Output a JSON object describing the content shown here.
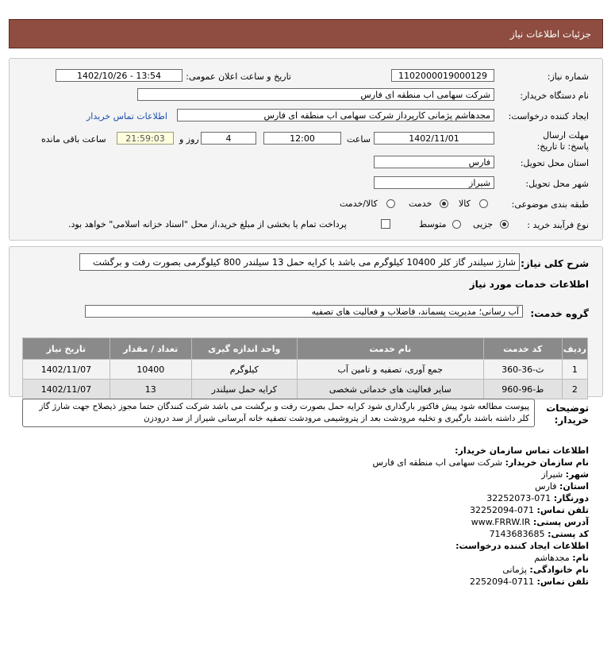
{
  "header": {
    "title": "جزئیات اطلاعات نیاز"
  },
  "fields": {
    "need_number_label": "شماره نیاز:",
    "need_number": "1102000019000129",
    "announce_label": "تاریخ و ساعت اعلان عمومی:",
    "announce_value": "1402/10/26 - 13:54",
    "buyer_org_label": "نام دستگاه خریدار:",
    "buyer_org": "شرکت سهامی اب منطقه ای فارس",
    "creator_label": "ایجاد کننده درخواست:",
    "creator": "مجدهاشم پژمانی کارپرداز شرکت سهامی اب منطقه ای فارس",
    "contact_link": "اطلاعات تماس خریدار",
    "deadline_label": "مهلت ارسال پاسخ: تا تاریخ:",
    "deadline_date": "1402/11/01",
    "time_label": "ساعت",
    "deadline_time": "12:00",
    "days": "4",
    "days_label": "روز و",
    "remaining_time": "21:59:03",
    "remaining_label": "ساعت باقی مانده",
    "province_label": "استان محل تحویل:",
    "province": "فارس",
    "city_label": "شهر محل تحویل:",
    "city": "شیراز",
    "category_label": "طبقه بندی موضوعی:",
    "category_options": [
      "کالا",
      "خدمت",
      "کالا/خدمت"
    ],
    "category_selected": "خدمت",
    "process_label": "نوع فرآیند خرید :",
    "process_options": [
      "جزیی",
      "متوسط"
    ],
    "process_selected": "جزیی",
    "treasury_text": "پرداخت تمام یا بخشی از مبلغ خرید،از محل \"اسناد خزانه اسلامی\" خواهد بود."
  },
  "description": {
    "label": "شرح کلی نیاز:",
    "text": "شارژ سیلندر گاز کلر 10400 کیلوگرم می باشد با کرایه حمل 13 سیلندر 800 کیلوگرمی بصورت رفت و برگشت"
  },
  "services": {
    "section_title": "اطلاعات خدمات مورد نیاز",
    "group_label": "گروه خدمت:",
    "group_value": "آب رسانی؛ مدیریت پسماند، فاضلاب و فعالیت های تصفیه",
    "columns": [
      "ردیف",
      "کد خدمت",
      "نام خدمت",
      "واحد اندازه گیری",
      "تعداد / مقدار",
      "تاریخ نیاز"
    ],
    "rows": [
      {
        "idx": "1",
        "code": "ث-36-360",
        "name": "جمع آوری، تصفیه و تامین آب",
        "unit": "کیلوگرم",
        "qty": "10400",
        "date": "1402/11/07"
      },
      {
        "idx": "2",
        "code": "ط-96-960",
        "name": "سایر فعالیت های خدماتی شخصی",
        "unit": "کرایه حمل سیلندر",
        "qty": "13",
        "date": "1402/11/07"
      }
    ]
  },
  "buyer_notes": {
    "label": "توضیحات خریدار:",
    "text": "پیوست مطالعه شود پیش فاکتور بارگذاری شود کرایه حمل بصورت رفت و برگشت می باشد شرکت کنندگان حتما مجوز ذیصلاح جهت شارژ گاز کلر داشته باشند بارگیری و تخلیه مرودشت بعد از پتروشیمی مرودشت تصفیه خانه آبرسانی شیراز از سد درودزن"
  },
  "contact": {
    "title": "اطلاعات تماس سازمان خریدار:",
    "org_label": "نام سازمان خریدار:",
    "org": "شرکت سهامی اب منطقه ای فارس",
    "city_label": "شهر:",
    "city": "شیراز",
    "province_label": "استان:",
    "province": "فارس",
    "fax_label": "دورنگار:",
    "fax": "071-32252073",
    "phone_label": "تلفن تماس:",
    "phone": "071-32252094",
    "web_label": "آدرس پستی:",
    "web": "www.FRRW.IR",
    "postal_label": "کد پستی:",
    "postal": "7143683685",
    "creator_title": "اطلاعات ایجاد کننده درخواست:",
    "name_label": "نام:",
    "name": "مجدهاشم",
    "family_label": "نام خانوادگی:",
    "family": "پژمانی",
    "creator_phone_label": "تلفن تماس:",
    "creator_phone": "0711-2252094"
  }
}
